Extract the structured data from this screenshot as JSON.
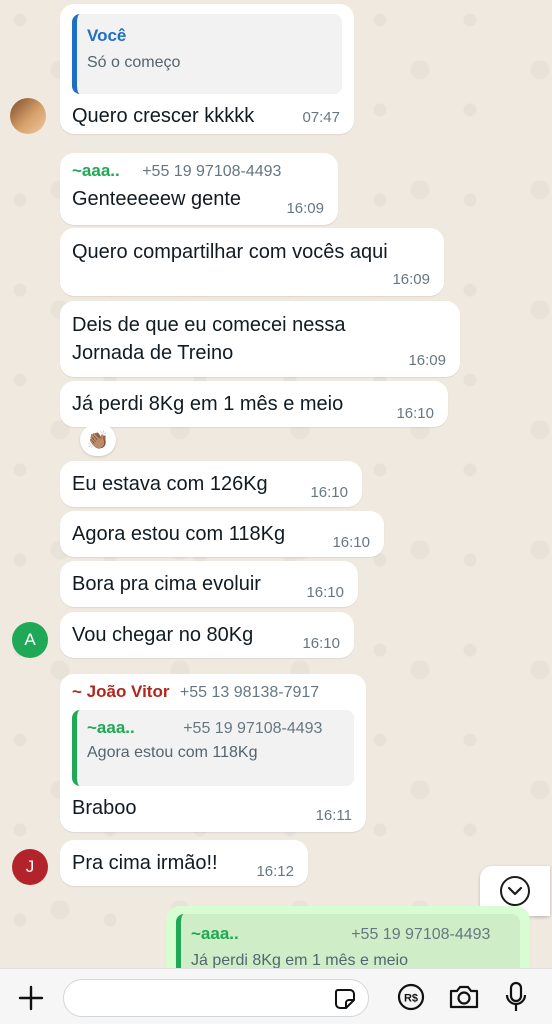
{
  "messages": {
    "m1": {
      "quote_name": "Você",
      "quote_text": "Só o começo",
      "text": "Quero crescer kkkkk",
      "time": "07:47"
    },
    "m2": {
      "sender": "~aaa..",
      "phone": "+55 19 97108-4493",
      "text": "Genteeeeew gente",
      "time": "16:09"
    },
    "m3": {
      "text": "Quero compartilhar com vocês aqui",
      "time": "16:09"
    },
    "m4": {
      "line1": "Deis de que eu comecei nessa",
      "line2": "Jornada de Treino",
      "time": "16:09"
    },
    "m5": {
      "text": "Já perdi 8Kg em 1 mês e meio",
      "time": "16:10",
      "reaction": "👏🏽"
    },
    "m6": {
      "text": "Eu estava com 126Kg",
      "time": "16:10"
    },
    "m7": {
      "text": "Agora estou com 118Kg",
      "time": "16:10"
    },
    "m8": {
      "text": "Bora pra cima evoluir",
      "time": "16:10"
    },
    "m9": {
      "avatar_letter": "A",
      "text": "Vou chegar no 80Kg",
      "time": "16:10"
    },
    "m10": {
      "sender": "~ João Vitor",
      "phone": "+55 13 98138-7917",
      "quote_name": "~aaa..",
      "quote_phone": "+55 19 97108-4493",
      "quote_text": "Agora estou com 118Kg",
      "text": "Braboo",
      "time": "16:11"
    },
    "m11": {
      "avatar_letter": "J",
      "text": "Pra cima irmão!!",
      "time": "16:12"
    },
    "m12": {
      "quote_name": "~aaa..",
      "quote_phone": "+55 19 97108-4493",
      "quote_text": "Já perdi 8Kg em 1 mês e meio"
    }
  },
  "colors": {
    "you_name": "#1f6fc5",
    "aaa_name": "#1fa855",
    "joao_name": "#b3261e",
    "avatar_a": "#1fa855",
    "avatar_j": "#b3232b",
    "outgoing_bubble": "#d9fdd3"
  },
  "icons": [
    "plus-icon",
    "sticker-icon",
    "currency-icon",
    "camera-icon",
    "microphone-icon",
    "chevron-down-icon"
  ]
}
